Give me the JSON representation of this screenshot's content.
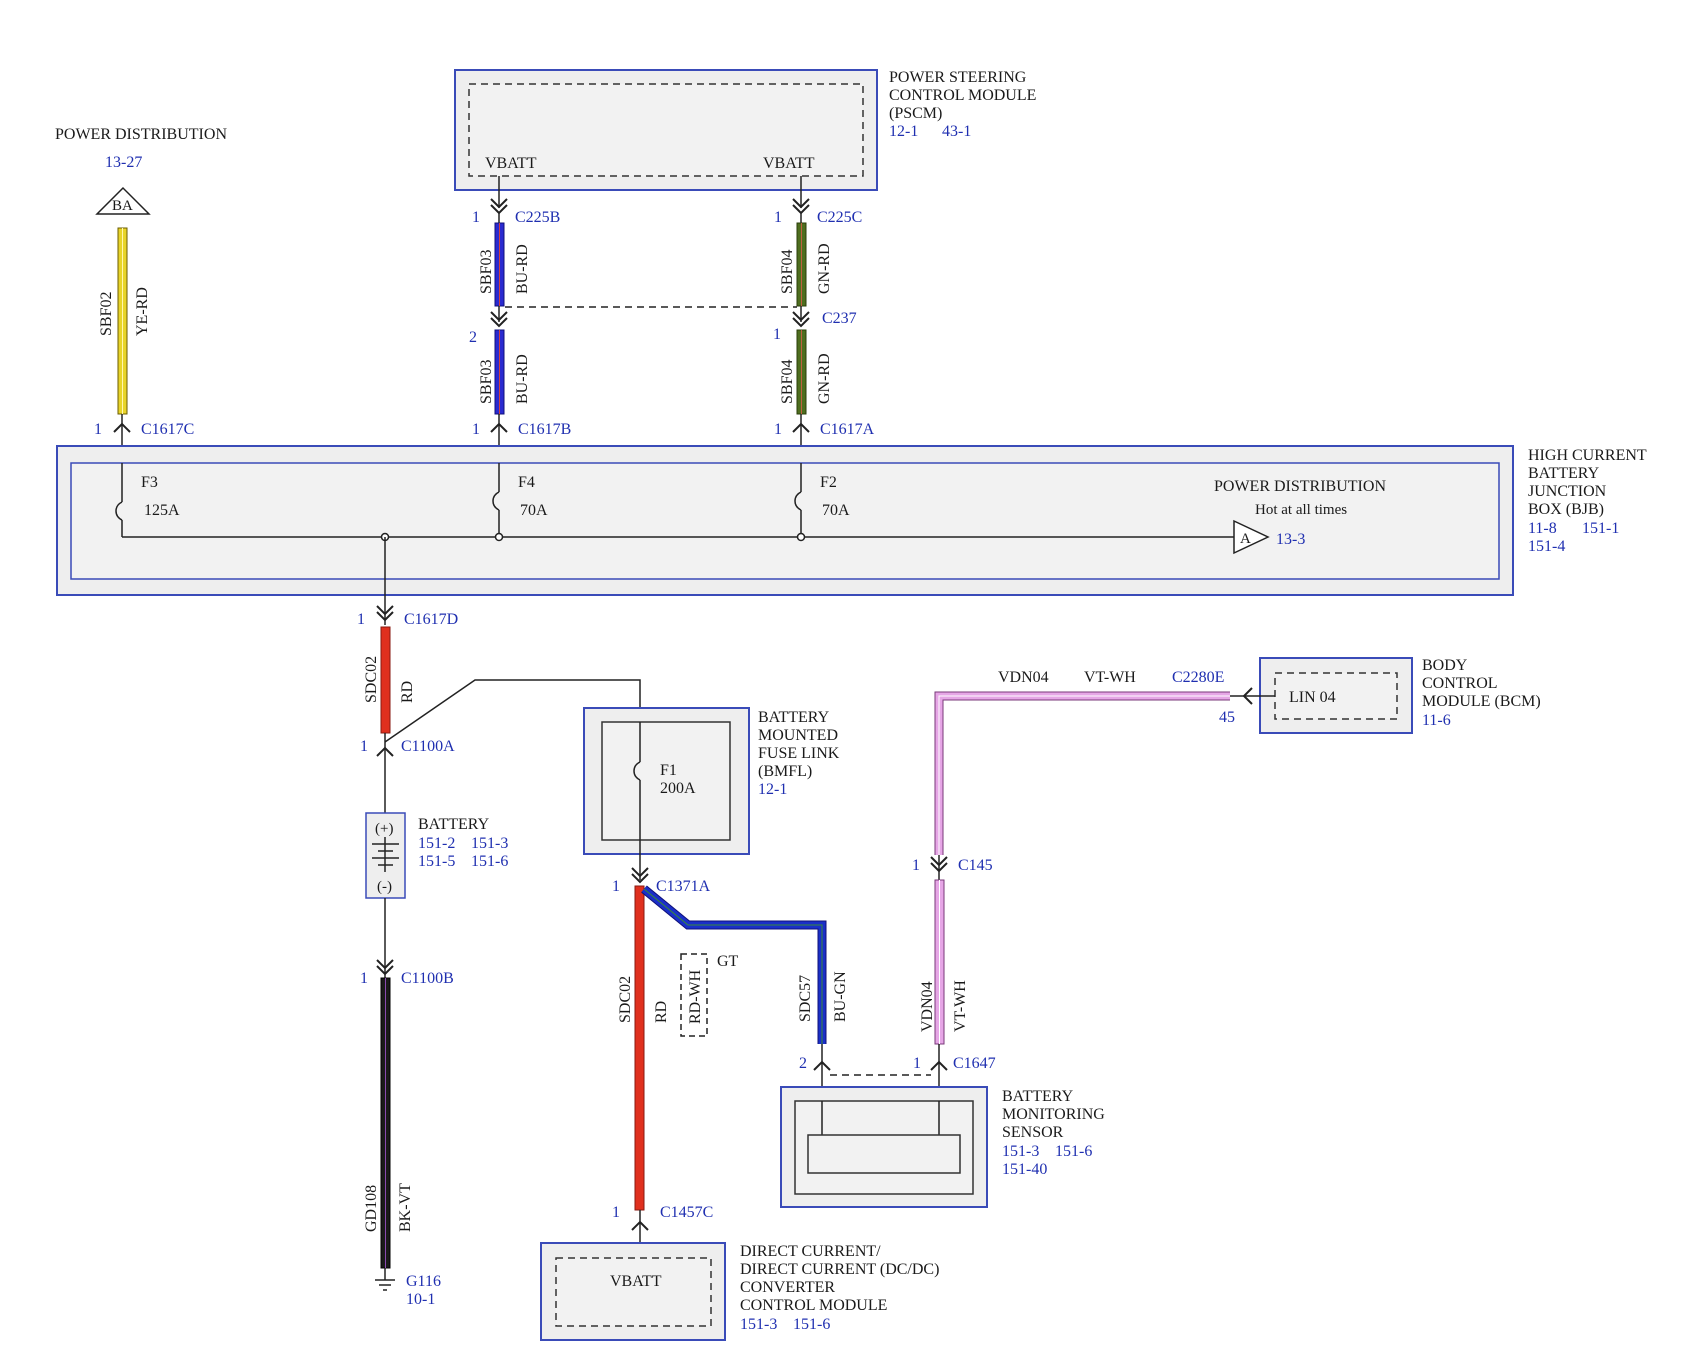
{
  "power_distribution_top": {
    "title": "POWER DISTRIBUTION",
    "ref": "13-27",
    "pin": "BA"
  },
  "pscm": {
    "name_lines": [
      "POWER STEERING",
      "CONTROL MODULE",
      "(PSCM)"
    ],
    "refs": [
      "12-1",
      "43-1"
    ],
    "pin_left": "VBATT",
    "pin_right": "VBATT"
  },
  "wires": {
    "sbf02": {
      "circuit": "SBF02",
      "color": "YE-RD"
    },
    "sbf03_upper": {
      "circuit": "SBF03",
      "color": "BU-RD"
    },
    "sbf03_lower": {
      "circuit": "SBF03",
      "color": "BU-RD"
    },
    "sbf04_upper": {
      "circuit": "SBF04",
      "color": "GN-RD"
    },
    "sbf04_lower": {
      "circuit": "SBF04",
      "color": "GN-RD"
    },
    "sdc02_upper": {
      "circuit": "SDC02",
      "color": "RD"
    },
    "gd108": {
      "circuit": "GD108",
      "color": "BK-VT"
    },
    "sdc02_lower": {
      "circuit": "SDC02",
      "color": "RD"
    },
    "rd_wh": {
      "color": "RD-WH",
      "note": "GT"
    },
    "sdc57": {
      "circuit": "SDC57",
      "color": "BU-GN"
    },
    "vdn04_vertical": {
      "circuit": "VDN04",
      "color": "VT-WH"
    },
    "vdn04_horizontal": {
      "circuit": "VDN04",
      "color": "VT-WH"
    }
  },
  "connectors": {
    "c225b": {
      "id": "C225B",
      "pin": "1"
    },
    "c225c": {
      "id": "C225C",
      "pin": "1"
    },
    "c237": {
      "id": "C237",
      "pin_left": "2",
      "pin_right": "1"
    },
    "c1617c": {
      "id": "C1617C",
      "pin": "1"
    },
    "c1617b": {
      "id": "C1617B",
      "pin": "1"
    },
    "c1617a": {
      "id": "C1617A",
      "pin": "1"
    },
    "c1617d": {
      "id": "C1617D",
      "pin": "1"
    },
    "c1100a": {
      "id": "C1100A",
      "pin": "1"
    },
    "c1100b": {
      "id": "C1100B",
      "pin": "1"
    },
    "c1371a": {
      "id": "C1371A",
      "pin": "1"
    },
    "c1457c": {
      "id": "C1457C",
      "pin": "1"
    },
    "c145": {
      "id": "C145",
      "pin": "1"
    },
    "c1647": {
      "id": "C1647",
      "pin_left": "2",
      "pin_right": "1"
    },
    "c2280e": {
      "id": "C2280E",
      "pin": "45"
    }
  },
  "bjb": {
    "name_lines": [
      "HIGH CURRENT",
      "BATTERY",
      "JUNCTION",
      "BOX (BJB)"
    ],
    "refs_line1": [
      "11-8",
      "151-1"
    ],
    "refs_line2": [
      "151-4"
    ],
    "fuses": [
      {
        "name": "F3",
        "rating": "125A"
      },
      {
        "name": "F4",
        "rating": "70A"
      },
      {
        "name": "F2",
        "rating": "70A"
      }
    ],
    "power_distribution": {
      "title": "POWER DISTRIBUTION",
      "subtitle": "Hot at all times",
      "pin": "A",
      "ref": "13-3"
    }
  },
  "bmfl": {
    "name_lines": [
      "BATTERY",
      "MOUNTED",
      "FUSE LINK",
      "(BMFL)"
    ],
    "ref": "12-1",
    "fuse": {
      "name": "F1",
      "rating": "200A"
    }
  },
  "battery": {
    "name": "BATTERY",
    "refs_line1": [
      "151-2",
      "151-3"
    ],
    "refs_line2": [
      "151-5",
      "151-6"
    ],
    "plus": "(+)",
    "minus": "(-)"
  },
  "ground": {
    "id": "G116",
    "ref": "10-1"
  },
  "dcdc": {
    "name_lines": [
      "DIRECT CURRENT/",
      "DIRECT CURRENT (DC/DC)",
      "CONVERTER",
      "CONTROL MODULE"
    ],
    "refs": [
      "151-3",
      "151-6"
    ],
    "pin": "VBATT"
  },
  "bms": {
    "name_lines": [
      "BATTERY",
      "MONITORING",
      "SENSOR"
    ],
    "refs_line1": [
      "151-3",
      "151-6"
    ],
    "refs_line2": [
      "151-40"
    ]
  },
  "bcm": {
    "name_lines": [
      "BODY",
      "CONTROL",
      "MODULE (BCM)"
    ],
    "ref": "11-6",
    "pin": "LIN 04"
  },
  "colors": {
    "ye_rd": "#e8d42a",
    "bu_rd": "#2a2ad0",
    "gn_rd": "#4e6e1e",
    "rd": "#e0301e",
    "bk_vt": "#1a1a1a",
    "bu_gn": "#1a2fc8",
    "vt_wh": "#e6a6e6",
    "ref_text": "#1f2fb0",
    "box_stroke": "#3a4bb8"
  }
}
